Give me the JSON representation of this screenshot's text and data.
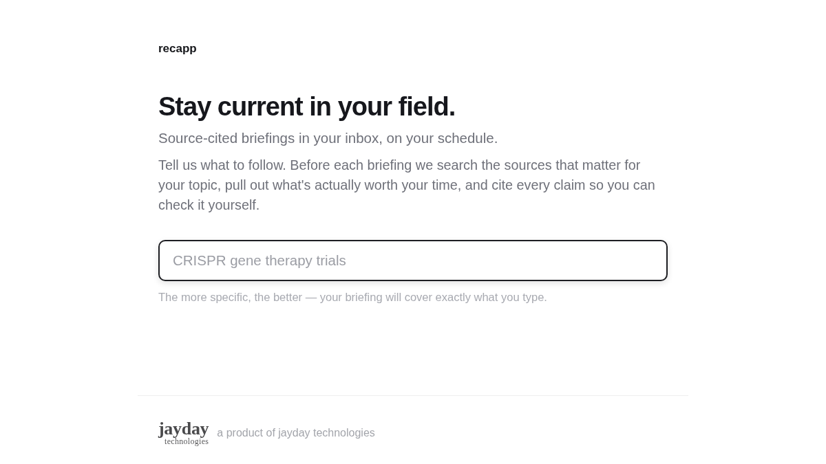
{
  "brand": {
    "name": "recapp"
  },
  "hero": {
    "title": "Stay current in your field.",
    "subtitle": "Source-cited briefings in your inbox, on your schedule.",
    "description": "Tell us what to follow. Before each briefing we search the sources that matter for your topic, pull out what's actually worth your time, and cite every claim so you can check it yourself."
  },
  "topic_input": {
    "placeholder": "CRISPR gene therapy trials",
    "hint": "The more specific, the better — your briefing will cover exactly what you type."
  },
  "footer": {
    "logo": {
      "wordmark": "jayday",
      "subtitle": "technologies"
    },
    "tagline": "a product of jayday technologies"
  }
}
